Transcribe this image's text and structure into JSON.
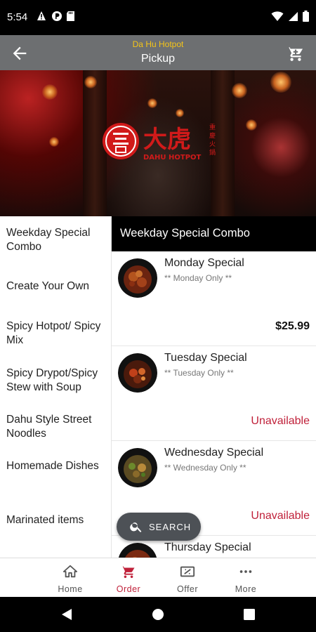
{
  "status_bar": {
    "time": "5:54"
  },
  "header": {
    "subtitle": "Da Hu Hotpot",
    "title": "Pickup"
  },
  "hero": {
    "logo_text": "DAHU HOTPOT",
    "logo_cn": "大虎",
    "logo_side": "重慶火鍋"
  },
  "sidebar": {
    "items": [
      {
        "label": "Weekday Special Combo"
      },
      {
        "label": "Create Your Own"
      },
      {
        "label": "Spicy Hotpot/ Spicy Mix"
      },
      {
        "label": "Spicy Drypot/Spicy Stew with Soup"
      },
      {
        "label": "Dahu Style Street Noodles"
      },
      {
        "label": "Homemade Dishes"
      },
      {
        "label": "Marinated items"
      }
    ]
  },
  "menu": {
    "section_title": "Weekday Special Combo",
    "items": [
      {
        "name": "Monday Special",
        "desc": "** Monday Only **",
        "price": "$25.99",
        "status": ""
      },
      {
        "name": "Tuesday Special",
        "desc": "** Tuesday Only **",
        "price": "",
        "status": "Unavailable"
      },
      {
        "name": "Wednesday Special",
        "desc": "** Wednesday Only **",
        "price": "",
        "status": "Unavailable"
      },
      {
        "name": "Thursday Special",
        "desc": "",
        "price": "",
        "status": ""
      }
    ]
  },
  "search": {
    "label": "SEARCH"
  },
  "bottom_nav": {
    "items": [
      {
        "label": "Home",
        "icon": "home-icon"
      },
      {
        "label": "Order",
        "icon": "order-icon"
      },
      {
        "label": "Offer",
        "icon": "offer-icon"
      },
      {
        "label": "More",
        "icon": "more-icon"
      }
    ]
  },
  "colors": {
    "accent": "#c0213a",
    "app_bar": "#6d6f71",
    "subtitle": "#f5c518"
  }
}
